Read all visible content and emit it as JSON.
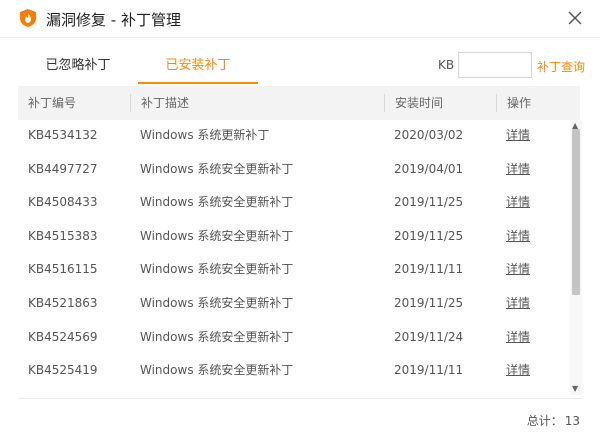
{
  "window": {
    "title": "漏洞修复 - 补丁管理"
  },
  "tabs": [
    {
      "label": "已忽略补丁",
      "active": false
    },
    {
      "label": "已安装补丁",
      "active": true
    }
  ],
  "search": {
    "label": "KB",
    "value": "",
    "placeholder": "",
    "button_label": "补丁查询"
  },
  "table": {
    "headers": [
      "补丁编号",
      "补丁描述",
      "安装时间",
      "操作"
    ],
    "rows": [
      {
        "id": "KB4534132",
        "desc": "Windows 系统更新补丁",
        "date": "2020/03/02",
        "action": "详情"
      },
      {
        "id": "KB4497727",
        "desc": "Windows 系统安全更新补丁",
        "date": "2019/04/01",
        "action": "详情"
      },
      {
        "id": "KB4508433",
        "desc": "Windows 系统安全更新补丁",
        "date": "2019/11/25",
        "action": "详情"
      },
      {
        "id": "KB4515383",
        "desc": "Windows 系统安全更新补丁",
        "date": "2019/11/25",
        "action": "详情"
      },
      {
        "id": "KB4516115",
        "desc": "Windows 系统安全更新补丁",
        "date": "2019/11/11",
        "action": "详情"
      },
      {
        "id": "KB4521863",
        "desc": "Windows 系统安全更新补丁",
        "date": "2019/11/25",
        "action": "详情"
      },
      {
        "id": "KB4524569",
        "desc": "Windows 系统安全更新补丁",
        "date": "2019/11/24",
        "action": "详情"
      },
      {
        "id": "KB4525419",
        "desc": "Windows 系统安全更新补丁",
        "date": "2019/11/11",
        "action": "详情"
      }
    ]
  },
  "footer": {
    "total_label": "总计：",
    "total_count": "13"
  },
  "colors": {
    "accent": "#ff8a00",
    "header_bg": "#f3f3f3",
    "scroll_thumb": "#c4c4c4"
  },
  "icons": {
    "app": "flame-shield-icon",
    "close": "close-icon"
  }
}
